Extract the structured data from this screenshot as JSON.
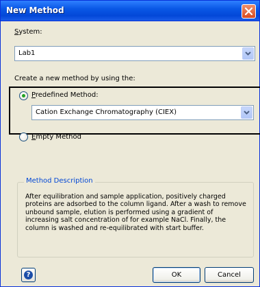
{
  "window": {
    "title": "New Method"
  },
  "system": {
    "label_underlined": "S",
    "label_rest": "ystem:",
    "value": "Lab1"
  },
  "create_prompt": "Create a new method by using the:",
  "predefined": {
    "label_underlined": "P",
    "label_rest": "redefined Method:",
    "selected": true,
    "value": "Cation Exchange Chromatography (CIEX)"
  },
  "empty": {
    "label_underlined": "E",
    "label_rest": "mpty Method",
    "selected": false
  },
  "description": {
    "title": "Method Description",
    "text": "After equilibration and sample application, positively charged proteins are adsorbed to the column ligand. After a wash to remove unbound sample, elution is performed using a gradient of increasing salt concentration of for example NaCl. Finally, the column is washed and re-equilibrated with start buffer."
  },
  "buttons": {
    "help": "?",
    "ok": "OK",
    "cancel": "Cancel"
  },
  "colors": {
    "titlebar": "#0a58e6",
    "group_title": "#0046d5",
    "radio_dot": "#21a121",
    "dialog_bg": "#ece9d8"
  },
  "icons": {
    "close": "close-icon",
    "dropdown": "chevron-down-icon",
    "help": "help-icon"
  }
}
